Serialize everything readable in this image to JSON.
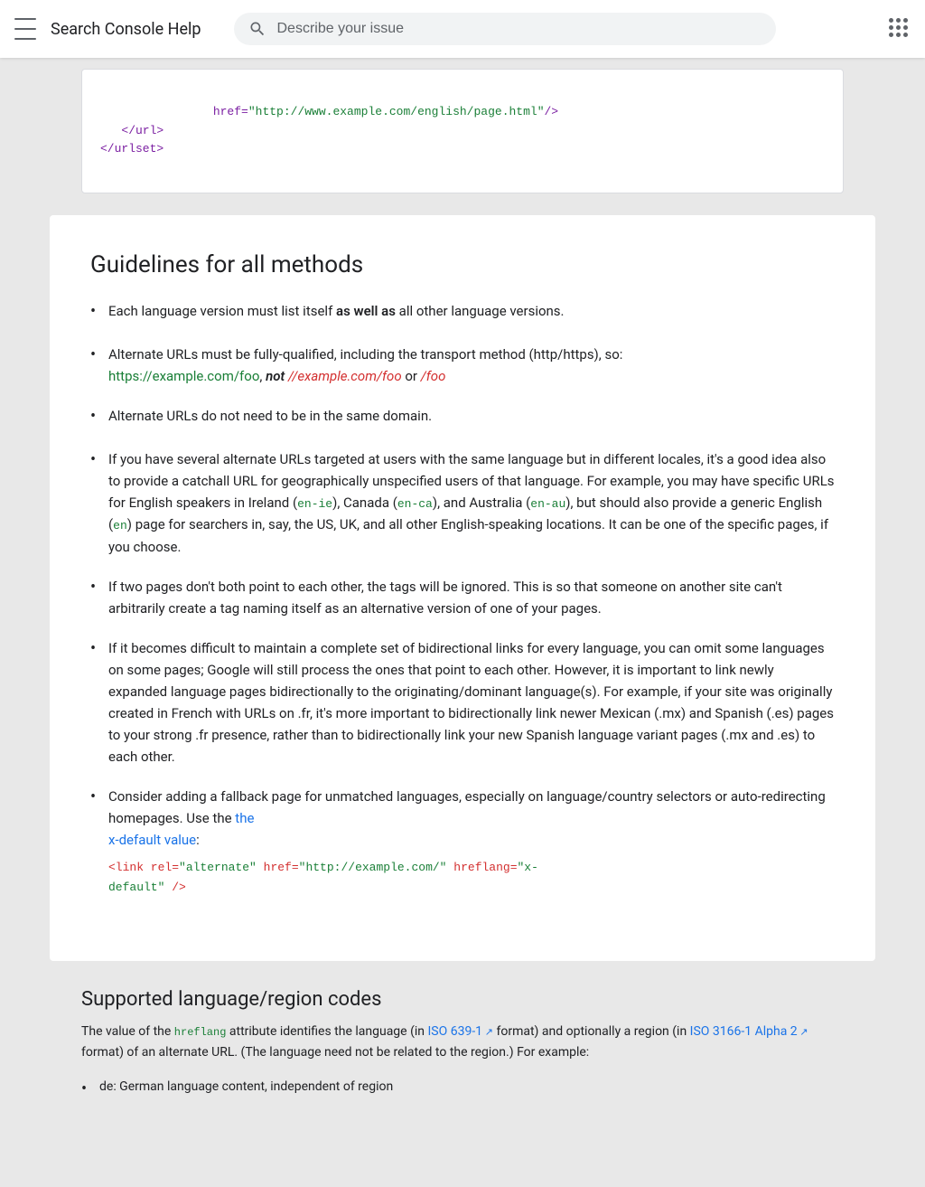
{
  "header": {
    "menu_label": "Menu",
    "logo_text": "Search Console Help",
    "search_placeholder": "Describe your issue",
    "dots_label": "Google apps"
  },
  "code_top": {
    "lines": [
      {
        "indent": "          ",
        "text": "href=\"http://www.example.com/english/page.html\"/>",
        "color": "purple"
      },
      {
        "indent": "   ",
        "text": "</url>",
        "color": "purple"
      },
      {
        "indent": "",
        "text": "</urlset>",
        "color": "purple"
      }
    ]
  },
  "guidelines": {
    "title": "Guidelines for all methods",
    "bullets": [
      {
        "id": 1,
        "text_parts": [
          {
            "text": "Each language version must list itself ",
            "type": "normal"
          },
          {
            "text": "as well as",
            "type": "bold"
          },
          {
            "text": " all other language versions.",
            "type": "normal"
          }
        ]
      },
      {
        "id": 2,
        "text_parts": [
          {
            "text": "Alternate URLs must be fully-qualified, including the transport method (http/https), so: ",
            "type": "normal"
          },
          {
            "text": "https://example.com/foo",
            "type": "link-green"
          },
          {
            "text": ", ",
            "type": "normal"
          },
          {
            "text": "not",
            "type": "italic-bold"
          },
          {
            "text": " ",
            "type": "normal"
          },
          {
            "text": "//example.com/foo",
            "type": "link-red"
          },
          {
            "text": " or ",
            "type": "normal"
          },
          {
            "text": "/foo",
            "type": "link-red"
          }
        ]
      },
      {
        "id": 3,
        "text_parts": [
          {
            "text": "Alternate URLs do not need to be in the same domain.",
            "type": "normal"
          }
        ]
      },
      {
        "id": 4,
        "text_parts": [
          {
            "text": "If you have several alternate URLs targeted at users with the same language but in different locales, it's a good idea also to provide a catchall URL for geographically unspecified users of that language. For example, you may have specific URLs for English speakers in Ireland (",
            "type": "normal"
          },
          {
            "text": "en-ie",
            "type": "code-green"
          },
          {
            "text": "), Canada (",
            "type": "normal"
          },
          {
            "text": "en-ca",
            "type": "code-green"
          },
          {
            "text": "), and Australia (",
            "type": "normal"
          },
          {
            "text": "en-au",
            "type": "code-green"
          },
          {
            "text": "), but should also provide a generic English (",
            "type": "normal"
          },
          {
            "text": "en",
            "type": "code-green"
          },
          {
            "text": ") page for searchers in, say, the US, UK, and all other English-speaking locations. It can be one of the specific pages, if you choose.",
            "type": "normal"
          }
        ]
      },
      {
        "id": 5,
        "text_parts": [
          {
            "text": "If two pages don't both point to each other, the tags will be ignored. This is so that someone on another site can't arbitrarily create a tag naming itself as an alternative version of one of your pages.",
            "type": "normal"
          }
        ]
      },
      {
        "id": 6,
        "text_parts": [
          {
            "text": "If it becomes difficult to maintain a complete set of bidirectional links for every language, you can omit some languages on some pages; Google will still process the ones that point to each other. However, it is important to link newly expanded language pages bidirectionally to the originating/dominant language(s). For example, if your site was originally created in French with URLs on .fr, it's more important to bidirectionally link newer Mexican (.mx) and Spanish (.es) pages to your strong .fr presence, rather than to bidirectionally link your new Spanish language variant pages (.mx and .es) to each other.",
            "type": "normal"
          }
        ]
      },
      {
        "id": 7,
        "text_parts": [
          {
            "text": "Consider adding a fallback page for unmatched languages, especially on language/country selectors or auto-redirecting homepages. Use the ",
            "type": "normal"
          },
          {
            "text": "the x-default value",
            "type": "link-blue"
          },
          {
            "text": ":",
            "type": "normal"
          }
        ],
        "code_block": "<link rel=\"alternate\" href=\"http://example.com/\" hreflang=\"x-\ndefault\" />"
      }
    ]
  },
  "supported": {
    "title": "Supported language/region codes",
    "desc_parts": [
      {
        "text": "The value of the ",
        "type": "normal"
      },
      {
        "text": "hreflang",
        "type": "code-green"
      },
      {
        "text": " attribute identifies the language (in ",
        "type": "normal"
      },
      {
        "text": "ISO 639-1",
        "type": "link-blue"
      },
      {
        "text": " format) and optionally a region (in ",
        "type": "normal"
      },
      {
        "text": "ISO 3166-1 Alpha 2",
        "type": "link-blue-external"
      },
      {
        "text": " format) of an alternate URL. (The language need not be related to the region.) For example:",
        "type": "normal"
      }
    ],
    "example_bullet": "de: German language content, independent of region"
  }
}
